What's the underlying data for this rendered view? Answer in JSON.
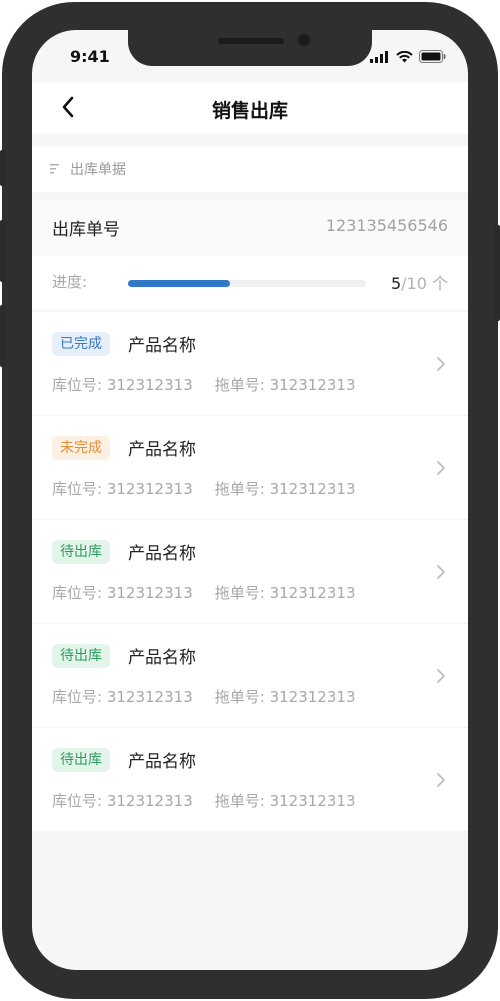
{
  "status_bar": {
    "time": "9:41"
  },
  "nav": {
    "title": "销售出库"
  },
  "section": {
    "label": "出库单据"
  },
  "order": {
    "label": "出库单号",
    "number": "123135456546"
  },
  "progress": {
    "label": "进度:",
    "current": "5",
    "total_text": "/10 个",
    "fraction": 0.43
  },
  "items": [
    {
      "status": "已完成",
      "status_color": "#3778c6",
      "name": "产品名称",
      "location_label": "库位号:",
      "location": "312312313",
      "drag_label": "拖单号:",
      "drag_no": "312312313"
    },
    {
      "status": "未完成",
      "status_color": "#e48e34",
      "name": "产品名称",
      "location_label": "库位号:",
      "location": "312312313",
      "drag_label": "拖单号:",
      "drag_no": "312312313"
    },
    {
      "status": "待出库",
      "status_color": "#2f9c5c",
      "name": "产品名称",
      "location_label": "库位号:",
      "location": "312312313",
      "drag_label": "拖单号:",
      "drag_no": "312312313"
    },
    {
      "status": "待出库",
      "status_color": "#2f9c5c",
      "name": "产品名称",
      "location_label": "库位号:",
      "location": "312312313",
      "drag_label": "拖单号:",
      "drag_no": "312312313"
    },
    {
      "status": "待出库",
      "status_color": "#2f9c5c",
      "name": "产品名称",
      "location_label": "库位号:",
      "location": "312312313",
      "drag_label": "拖单号:",
      "drag_no": "312312313"
    }
  ],
  "icons": {
    "back": "chevron-left-icon",
    "section": "list-filter-icon",
    "row": "chevron-right-icon"
  }
}
